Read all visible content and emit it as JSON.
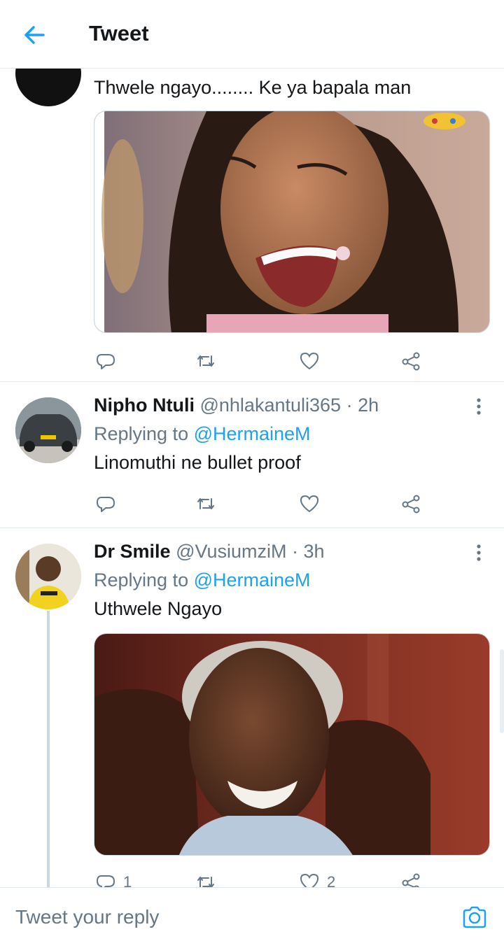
{
  "header": {
    "title": "Tweet",
    "back_icon": "arrow-left-icon"
  },
  "colors": {
    "accent": "#1da1f2",
    "muted": "#657786",
    "text": "#14171a",
    "divider": "#e1e8ed"
  },
  "tweets": [
    {
      "partial": true,
      "text": "Thwele ngayo........ Ke ya bapala man",
      "media": {
        "icon": "photo-woman-laughing"
      },
      "actions": {
        "reply_count": "",
        "retweet_count": "",
        "like_count": ""
      }
    },
    {
      "name": "Nipho Ntuli",
      "handle": "@nhlakantuli365",
      "separator": "·",
      "time": "2h",
      "replying_prefix": "Replying to",
      "replying_to": "@HermaineM",
      "text": "Linomuthi ne bullet proof",
      "actions": {
        "reply_count": "",
        "retweet_count": "",
        "like_count": ""
      }
    },
    {
      "name": "Dr Smile",
      "handle": "@VusiumziM",
      "separator": "·",
      "time": "3h",
      "replying_prefix": "Replying to",
      "replying_to": "@HermaineM",
      "text": "Uthwele Ngayo",
      "media": {
        "icon": "photo-man-smiling"
      },
      "actions": {
        "reply_count": "1",
        "retweet_count": "",
        "like_count": "2"
      }
    }
  ],
  "reply_bar": {
    "placeholder": "Tweet your reply",
    "camera_icon": "camera-icon"
  }
}
